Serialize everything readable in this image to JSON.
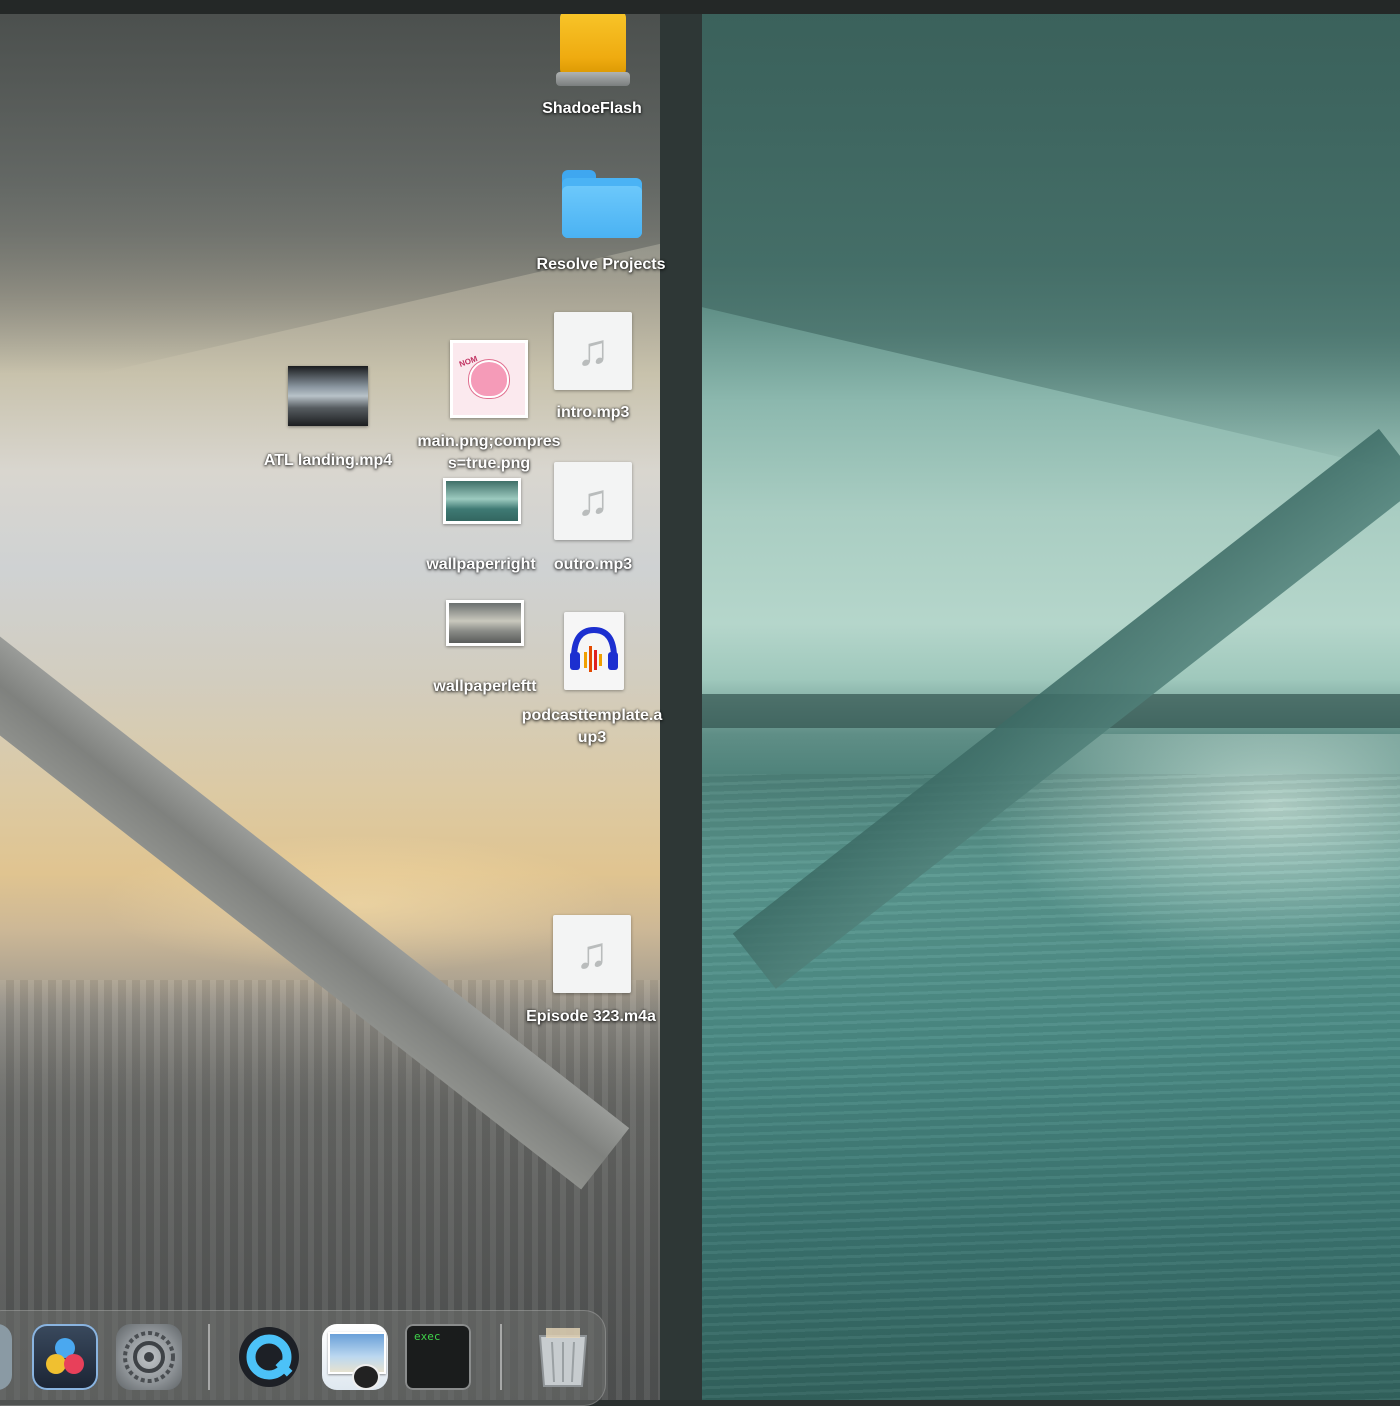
{
  "desktop_left": {
    "icons": {
      "drive": {
        "label": "ShadoeFlash",
        "icon": "external-drive-icon"
      },
      "folder": {
        "label": "Resolve Projects",
        "icon": "folder-icon"
      },
      "intro": {
        "label": "intro.mp3",
        "icon": "audio-file-icon"
      },
      "main_png": {
        "label": "main.png;compres\ns=true.png",
        "icon": "image-thumbnail-icon"
      },
      "atl": {
        "label": "ATL landing.mp4",
        "icon": "video-thumbnail-icon"
      },
      "wallpaperright": {
        "label": "wallpaperright",
        "icon": "image-thumbnail-icon"
      },
      "outro": {
        "label": "outro.mp3",
        "icon": "audio-file-icon"
      },
      "wallpaperleftt": {
        "label": "wallpaperleftt",
        "icon": "image-thumbnail-icon"
      },
      "podcast": {
        "label": "podcasttemplate.a\nup3",
        "icon": "audacity-project-icon"
      },
      "episode": {
        "label": "Episode 323.m4a",
        "icon": "audio-file-icon"
      }
    },
    "nom_text": "NOM"
  },
  "dock": {
    "apps": [
      {
        "name": "finder-partial",
        "icon": "finder-icon"
      },
      {
        "name": "davinci-resolve",
        "icon": "davinci-resolve-icon"
      },
      {
        "name": "system-settings",
        "icon": "gear-icon"
      },
      {
        "name": "quicktime",
        "icon": "quicktime-icon"
      },
      {
        "name": "preview",
        "icon": "preview-icon"
      },
      {
        "name": "terminal",
        "icon": "terminal-icon",
        "text": "exec"
      },
      {
        "name": "trash",
        "icon": "trash-icon"
      }
    ]
  },
  "colors": {
    "folder_blue": "#4ab3f5",
    "drive_yellow": "#f4b81c",
    "dock_glass": "rgba(110,112,110,0.55)",
    "label_text": "#ffffff"
  }
}
